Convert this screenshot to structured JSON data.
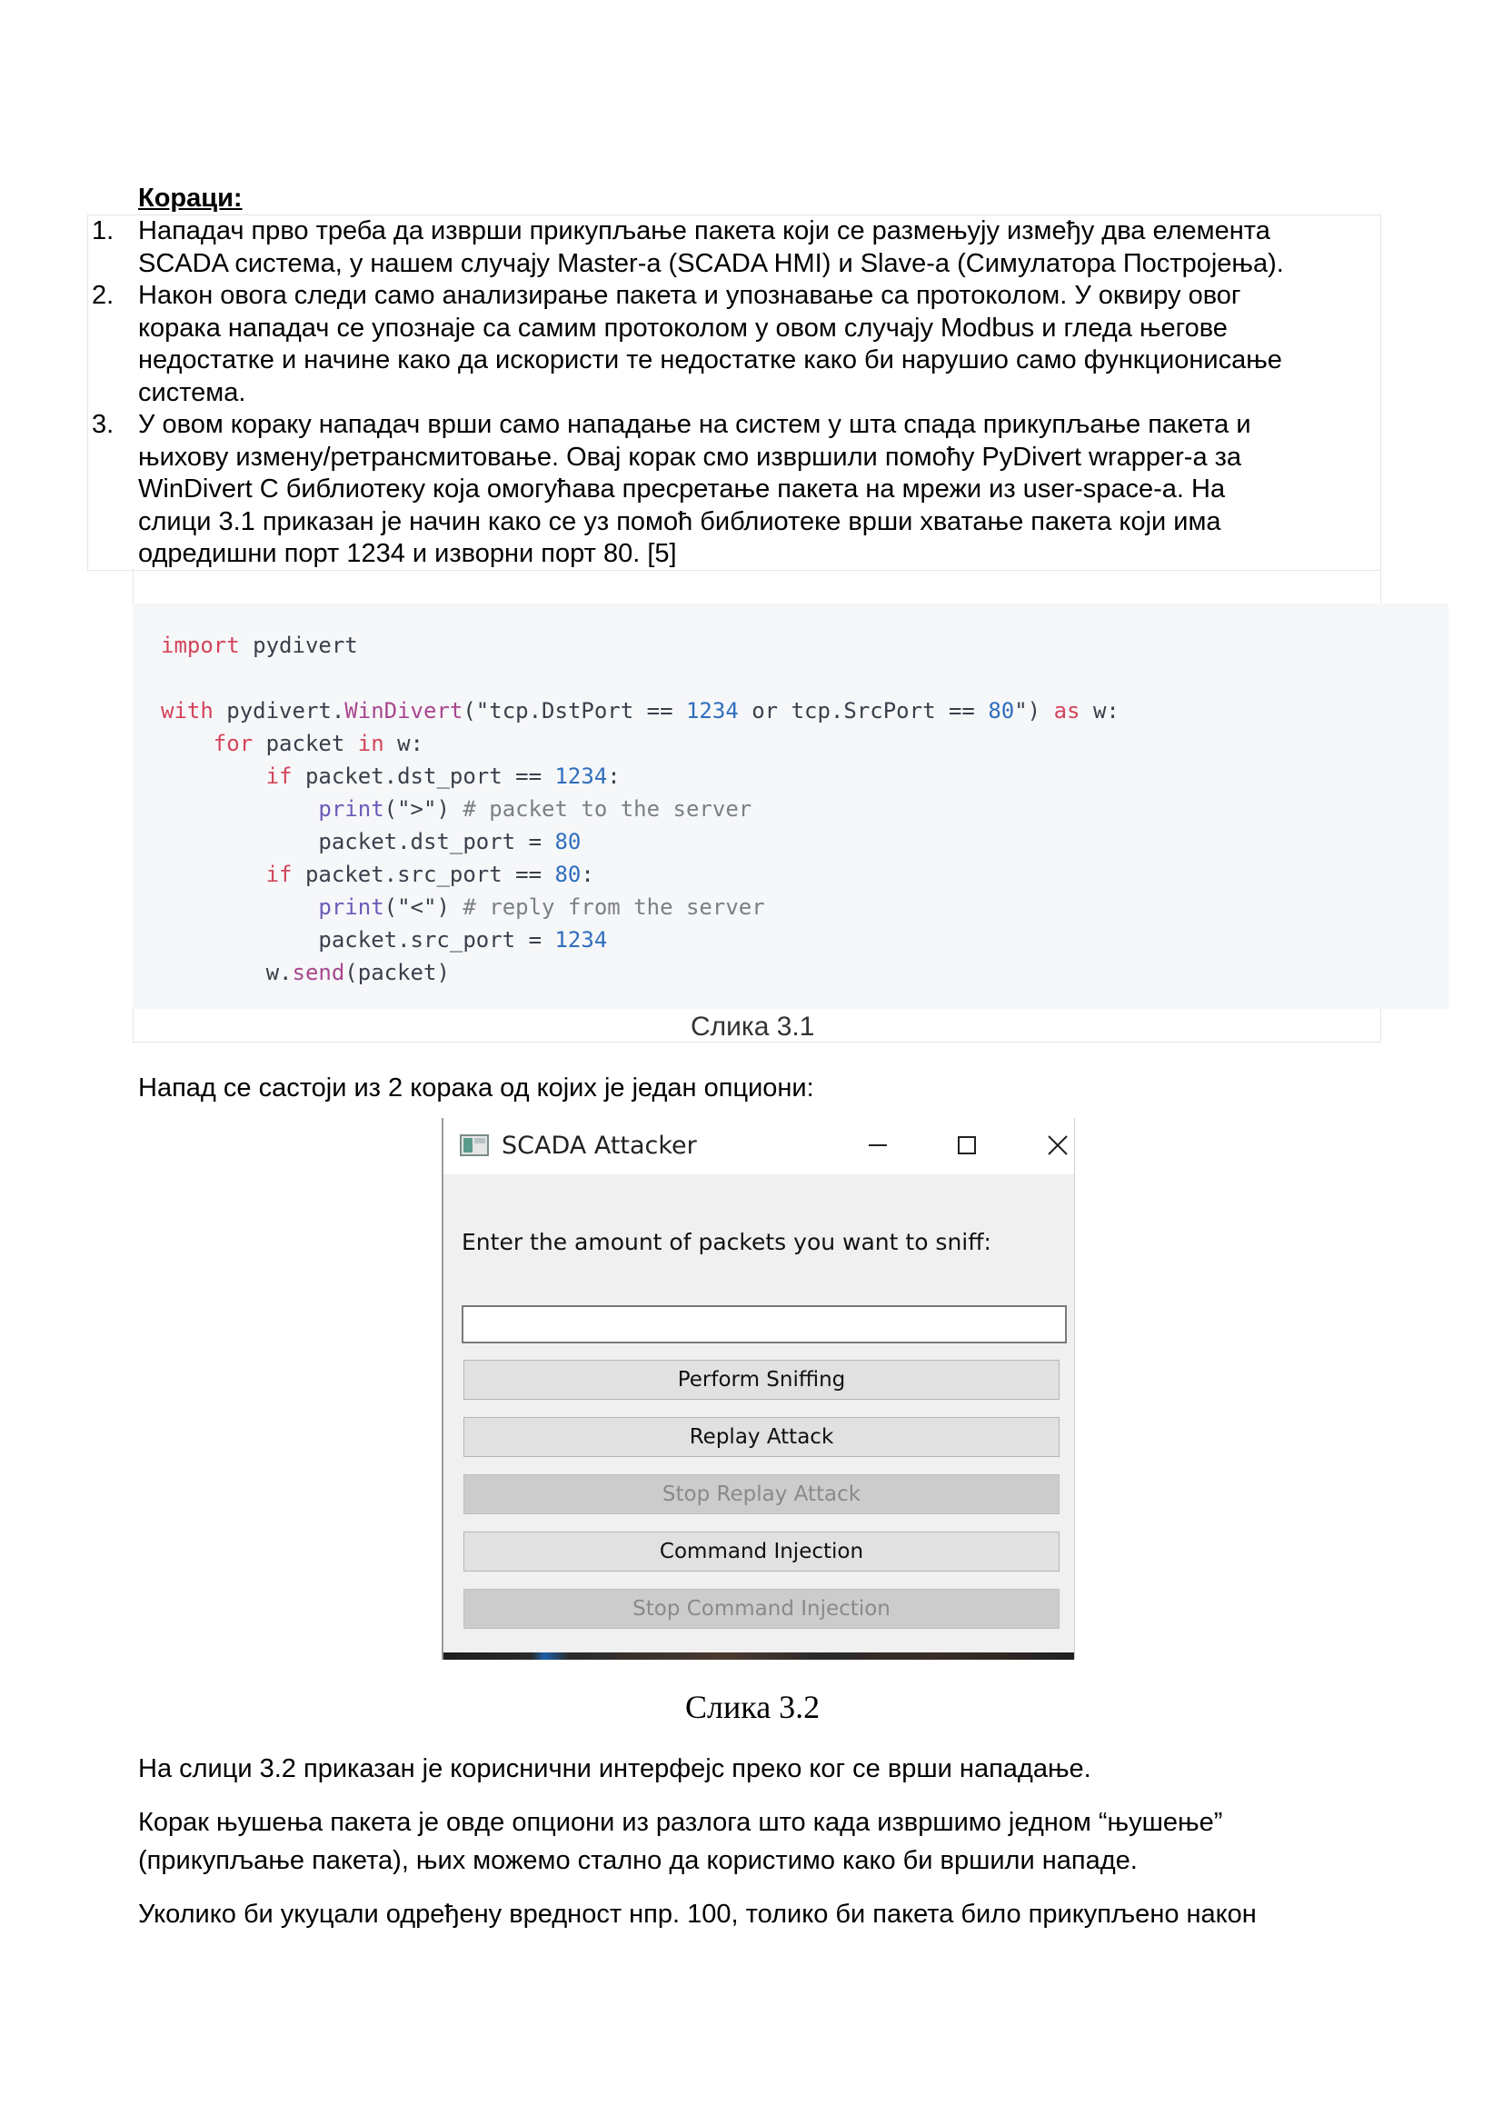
{
  "heading": "Кораци:",
  "steps": [
    {
      "num": "1.",
      "text": "Нападач прво треба да изврши прикупљање пакета који се размењују између два елемента\nSCADA система, у нашем случају Master-a (SCADA HMI) и Slave-a (Симулатора Постројења)."
    },
    {
      "num": "2.",
      "text": "Након овога следи само анализирање пакета и упознавање са протоколом. У оквиру овог\nкорака нападач се упознаје са самим протоколом у овом случају Modbus и гледа његове\nнедостатке и начине како да искористи те недостатке како би нарушио само функционисање\nсистема."
    },
    {
      "num": "3.",
      "text": "У овом кораку нападач врши само нападање на систем у шта спада прикупљање пакета и\nњихову измену/ретрансмитовање. Овај корак смо извршили помоћу PyDivert wrapper-a за\nWinDivert C библиотеку која омогућава пресретање пакета на мрежи из user-space-a. На\nслици 3.1 приказан је начин како се уз помоћ библиотеке врши хватање пакета који има\nодредишни порт 1234 и изворни порт 80. [5]"
    }
  ],
  "code": {
    "l1": [
      "import",
      " pydivert"
    ],
    "l2": [
      "with",
      " pydivert.",
      "WinDivert",
      "(\"tcp.DstPort == ",
      "1234",
      " or tcp.SrcPort == ",
      "80",
      "\") ",
      "as",
      " w:"
    ],
    "l3": [
      "    ",
      "for",
      " packet ",
      "in",
      " w:"
    ],
    "l4": [
      "        ",
      "if",
      " packet.dst_port == ",
      "1234",
      ":"
    ],
    "l5": [
      "            ",
      "print",
      "(\">\") ",
      "# packet to the server"
    ],
    "l6": [
      "            packet.dst_port = ",
      "80"
    ],
    "l7": [
      "        ",
      "if",
      " packet.src_port == ",
      "80",
      ":"
    ],
    "l8": [
      "            ",
      "print",
      "(\"<\") ",
      "# reply from the server"
    ],
    "l9": [
      "            packet.src_port = ",
      "1234"
    ],
    "l10": [
      "        w.",
      "send",
      "(packet)"
    ]
  },
  "caption_31": "Слика 3.1",
  "para_attack": "Напад се састоји из 2 корака од којих је један опциони:",
  "window": {
    "title": "SCADA Attacker",
    "minimize": "—",
    "prompt": "Enter the amount of packets you want to sniff:",
    "input_value": "",
    "buttons": {
      "sniff": "Perform Sniffing",
      "replay": "Replay Attack",
      "stop_replay": "Stop Replay Attack",
      "inject": "Command Injection",
      "stop_inject": "Stop Command Injection"
    }
  },
  "caption_32": "Слика 3.2",
  "para_ui": "На слици 3.2 приказан је кориснични интерфејс преко ког се врши нападање.",
  "para_optional": "Корак њушења пакета је овде опциони из разлога што када извршимо једном “њушење”\n(прикупљање пакета), њих можемо стално да користимо како би вршили нападе.",
  "para_value": "Уколико би укуцали одређену вредност нпр. 100, толико би пакета било прикупљено након",
  "colors": {
    "code_bg": "#f6f7f9",
    "keyword": "#d3455b",
    "number": "#2f6ebd",
    "comment": "#7d7f86"
  }
}
